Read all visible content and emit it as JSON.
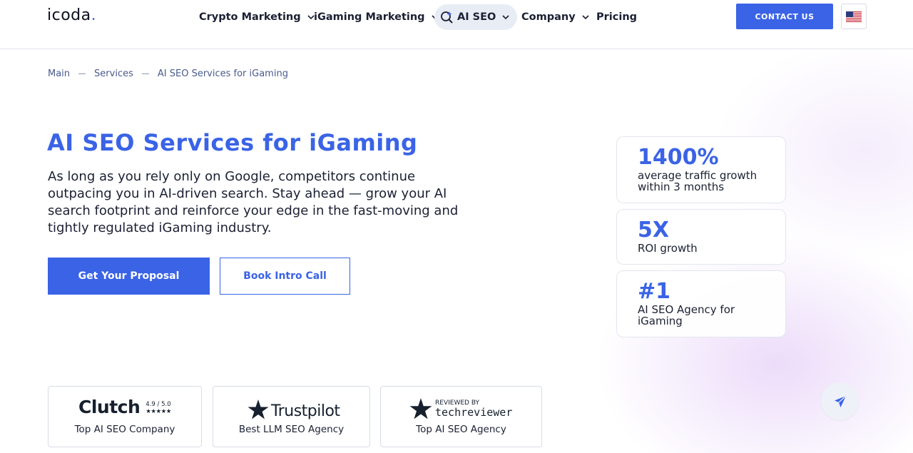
{
  "header": {
    "logo": "icoda",
    "logo_dot": ".",
    "nav": [
      {
        "label": "Crypto Marketing",
        "icon": "chevron-down-icon"
      },
      {
        "label": "iGaming Marketing",
        "icon": "chevron-down-icon"
      },
      {
        "label": "AI SEO",
        "icon": "chevron-down-icon",
        "leading_icon": "ai-search-icon"
      },
      {
        "label": "Company",
        "icon": "chevron-down-icon"
      },
      {
        "label": "Pricing"
      }
    ],
    "contact_label": "CONTACT US",
    "language_icon": "us-flag-icon"
  },
  "breadcrumb": [
    "Main",
    "Services",
    "AI SEO Services for iGaming"
  ],
  "hero": {
    "title": "AI SEO Services for iGaming",
    "text": "As long as you rely only on Google, competitors continue outpacing you in AI-driven search. Stay ahead — grow your AI search footprint and reinforce your edge in the fast-moving and tightly regulated iGaming industry.",
    "primary_button": "Get Your Proposal",
    "secondary_button": "Book Intro Call"
  },
  "stats": [
    {
      "value": "1400%",
      "label": "average traffic growth within 3 months"
    },
    {
      "value": "5X",
      "label": "ROI growth"
    },
    {
      "value": "#1",
      "label": "AI SEO Agency for iGaming"
    }
  ],
  "badges": {
    "clutch": {
      "logo": "Clutch",
      "rating": "4.9 / 5.0",
      "stars": "★★★★★",
      "caption": "Top AI SEO Company"
    },
    "trustpilot": {
      "logo": "Trustpilot",
      "caption": "Best LLM SEO Agency"
    },
    "techreviewer": {
      "reviewed_by": "REVIEWED BY",
      "logo": "techreviewer",
      "caption": "Top AI SEO Agency"
    }
  },
  "colors": {
    "accent": "#3a63e6",
    "text": "#1b2033"
  },
  "fab_icon": "send-icon"
}
